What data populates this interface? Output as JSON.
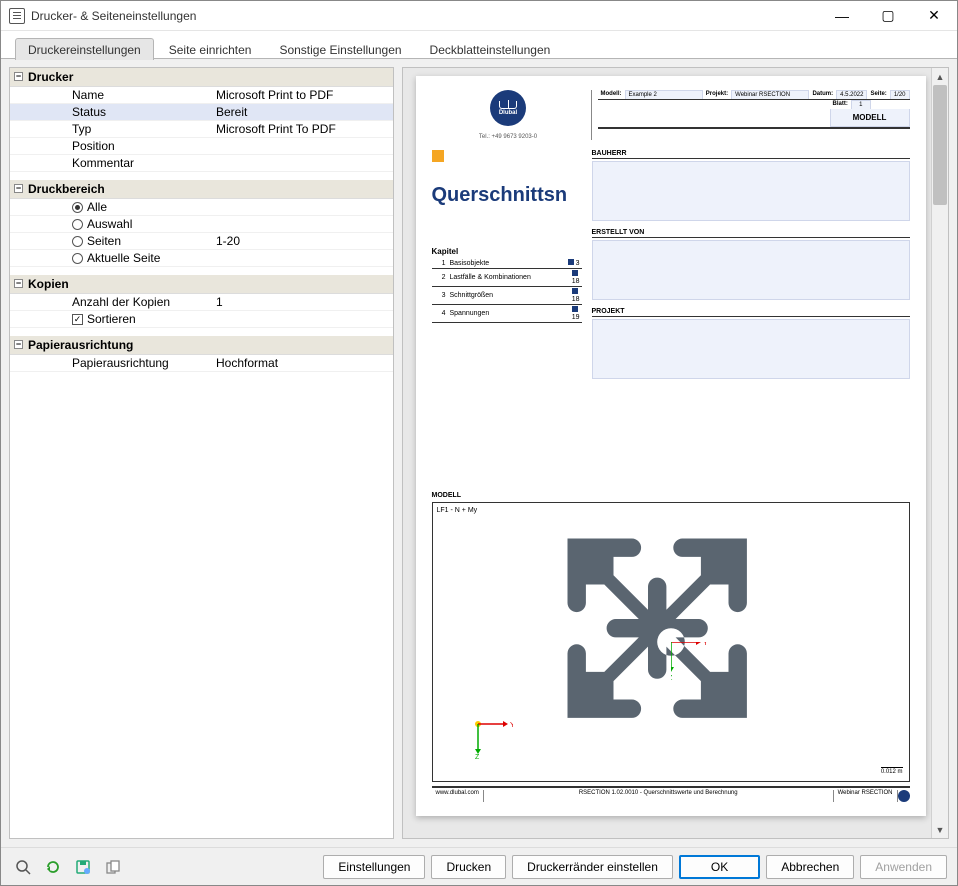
{
  "window": {
    "title": "Drucker- & Seiteneinstellungen"
  },
  "tabs": [
    "Druckereinstellungen",
    "Seite einrichten",
    "Sonstige Einstellungen",
    "Deckblatteinstellungen"
  ],
  "active_tab": 0,
  "grid": {
    "drucker": {
      "header": "Drucker",
      "name_label": "Name",
      "name_value": "Microsoft Print to PDF",
      "status_label": "Status",
      "status_value": "Bereit",
      "typ_label": "Typ",
      "typ_value": "Microsoft Print To PDF",
      "position_label": "Position",
      "position_value": "",
      "kommentar_label": "Kommentar",
      "kommentar_value": ""
    },
    "druckbereich": {
      "header": "Druckbereich",
      "alle": "Alle",
      "auswahl": "Auswahl",
      "seiten_label": "Seiten",
      "seiten_value": "1-20",
      "aktuelle": "Aktuelle Seite",
      "selected": "alle"
    },
    "kopien": {
      "header": "Kopien",
      "anzahl_label": "Anzahl der Kopien",
      "anzahl_value": "1",
      "sortieren_label": "Sortieren",
      "sortieren_checked": true
    },
    "papier": {
      "header": "Papierausrichtung",
      "label": "Papierausrichtung",
      "value": "Hochformat"
    }
  },
  "preview": {
    "tel": "Tel.: +49 9673 9203-0",
    "logo_name": "Dlubal",
    "meta": {
      "modell_lbl": "Modell:",
      "modell_val": "Example 2",
      "projekt_lbl": "Projekt:",
      "projekt_val": "Webinar RSECTION",
      "datum_lbl": "Datum:",
      "datum_val": "4.5.2022",
      "seite_lbl": "Seite:",
      "seite_val": "1/20",
      "blatt_lbl": "Blatt:",
      "blatt_val": "1"
    },
    "hdr_title": "MODELL",
    "cover_title": "Querschnittsn",
    "kapitel_header": "Kapitel",
    "kapitel": [
      {
        "n": "1",
        "name": "Basisobjekte",
        "page": "3"
      },
      {
        "n": "2",
        "name": "Lastfälle & Kombinationen",
        "page": "18"
      },
      {
        "n": "3",
        "name": "Schnittgrößen",
        "page": "18"
      },
      {
        "n": "4",
        "name": "Spannungen",
        "page": "19"
      }
    ],
    "sections": {
      "bauherr": "BAUHERR",
      "erstellt": "ERSTELLT VON",
      "projekt": "PROJEKT",
      "modell": "MODELL"
    },
    "model_case": "LF1 - N + My",
    "axis_y": "Y",
    "axis_z": "Z",
    "scale": "0.012 m",
    "footer": {
      "site": "www.dlubal.com",
      "prog": "RSECTION 1.02.0010 - Querschnittswerte und Berechnung",
      "proj": "Webinar RSECTION"
    }
  },
  "buttons": {
    "einstellungen": "Einstellungen",
    "drucken": "Drucken",
    "druckerraender": "Druckerränder einstellen",
    "ok": "OK",
    "abbrechen": "Abbrechen",
    "anwenden": "Anwenden"
  }
}
